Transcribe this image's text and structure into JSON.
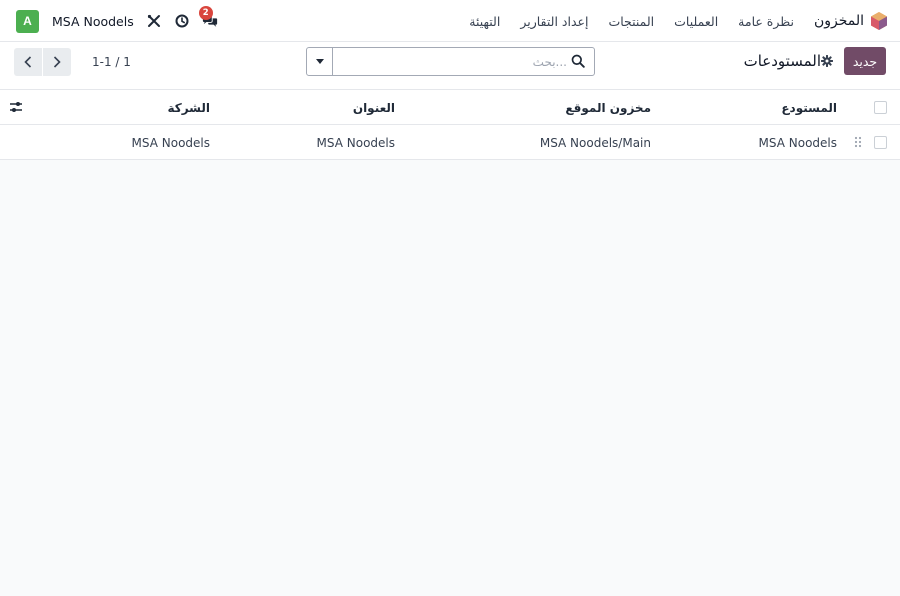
{
  "navbar": {
    "app_name": "المخزون",
    "menu": [
      "نظرة عامة",
      "العمليات",
      "المنتجات",
      "إعداد التقارير",
      "التهيئة"
    ],
    "company": "MSA Noodels",
    "avatar_letter": "A",
    "chat_badge": "2"
  },
  "control": {
    "new_button": "جديد",
    "title": "المستودعات",
    "search_placeholder": "بحث...",
    "pager": "1-1 / 1"
  },
  "table": {
    "columns": [
      "المستودع",
      "مخزون الموقع",
      "العنوان",
      "الشركة"
    ],
    "rows": [
      {
        "warehouse": "MSA Noodels",
        "location": "MSA Noodels/Main",
        "address": "MSA Noodels",
        "company": "MSA Noodels"
      }
    ]
  },
  "colors": {
    "brand": "#714b67",
    "avatar": "#4caf50",
    "badge": "#d9453d"
  }
}
